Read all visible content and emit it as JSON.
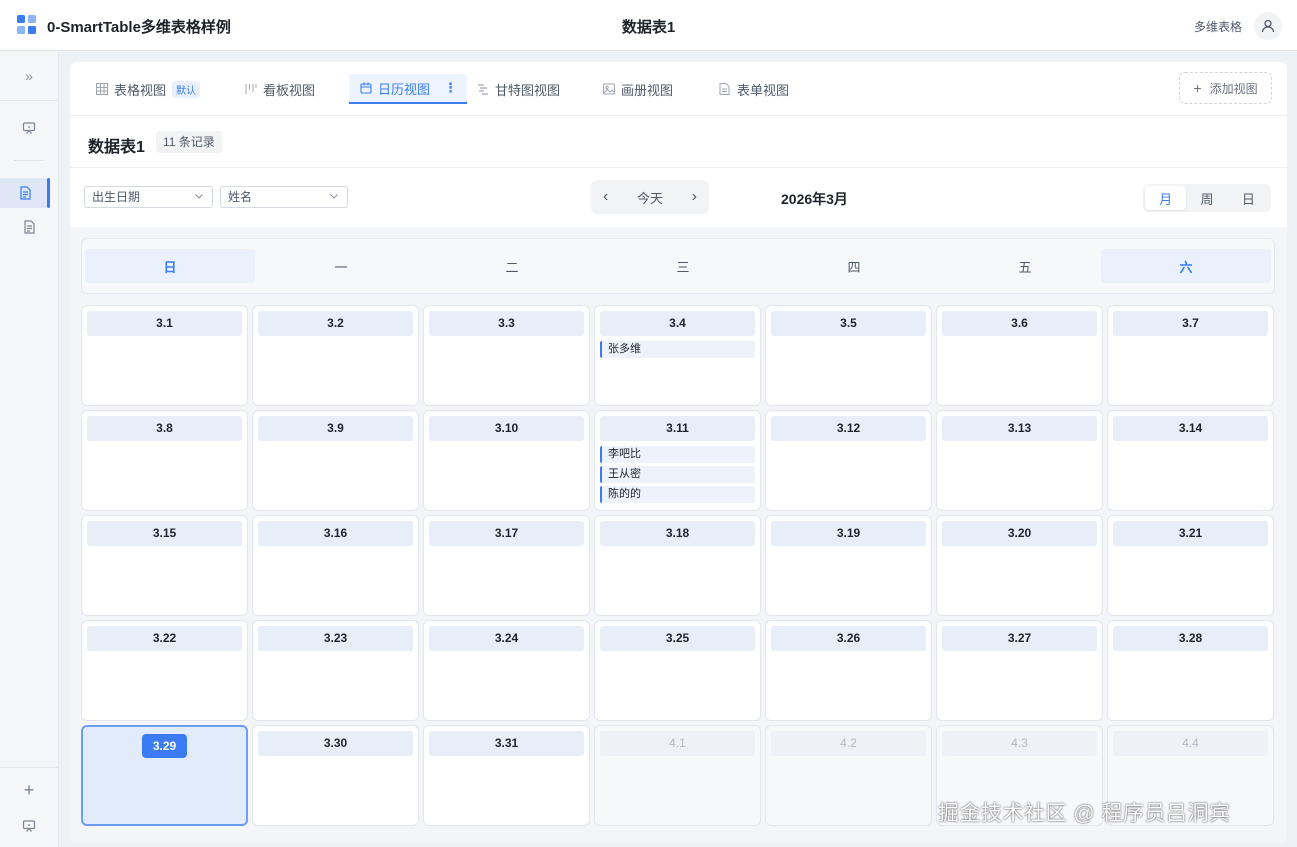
{
  "app": {
    "title": "0-SmartTable多维表格样例",
    "center_title": "数据表1",
    "right_label": "多维表格"
  },
  "tabs": [
    {
      "label": "表格视图",
      "badge": "默认",
      "icon": "grid-icon"
    },
    {
      "label": "看板视图",
      "icon": "kanban-icon"
    },
    {
      "label": "日历视图",
      "icon": "calendar-icon",
      "active": true
    },
    {
      "label": "甘特图视图",
      "icon": "gantt-icon"
    },
    {
      "label": "画册视图",
      "icon": "image-icon"
    },
    {
      "label": "表单视图",
      "icon": "form-icon"
    }
  ],
  "add_view_label": "添加视图",
  "table": {
    "name": "数据表1",
    "record_count": "11 条记录"
  },
  "toolbar": {
    "date_field": "出生日期",
    "title_field": "姓名",
    "prev": "‹",
    "today": "今天",
    "next": "›",
    "month_title": "2026年3月",
    "modes": [
      "月",
      "周",
      "日"
    ],
    "active_mode": "月"
  },
  "weekdays": [
    "日",
    "一",
    "二",
    "三",
    "四",
    "五",
    "六"
  ],
  "weeks": [
    [
      {
        "d": "3.1"
      },
      {
        "d": "3.2"
      },
      {
        "d": "3.3"
      },
      {
        "d": "3.4",
        "events": [
          "张多维"
        ]
      },
      {
        "d": "3.5"
      },
      {
        "d": "3.6"
      },
      {
        "d": "3.7"
      }
    ],
    [
      {
        "d": "3.8"
      },
      {
        "d": "3.9"
      },
      {
        "d": "3.10"
      },
      {
        "d": "3.11",
        "events": [
          "李吧比",
          "王从密",
          "陈的的"
        ]
      },
      {
        "d": "3.12"
      },
      {
        "d": "3.13"
      },
      {
        "d": "3.14"
      }
    ],
    [
      {
        "d": "3.15"
      },
      {
        "d": "3.16"
      },
      {
        "d": "3.17"
      },
      {
        "d": "3.18"
      },
      {
        "d": "3.19"
      },
      {
        "d": "3.20"
      },
      {
        "d": "3.21"
      }
    ],
    [
      {
        "d": "3.22"
      },
      {
        "d": "3.23"
      },
      {
        "d": "3.24"
      },
      {
        "d": "3.25"
      },
      {
        "d": "3.26"
      },
      {
        "d": "3.27"
      },
      {
        "d": "3.28"
      }
    ],
    [
      {
        "d": "3.29",
        "today": true
      },
      {
        "d": "3.30"
      },
      {
        "d": "3.31"
      },
      {
        "d": "4.1",
        "other": true
      },
      {
        "d": "4.2",
        "other": true
      },
      {
        "d": "4.3",
        "other": true
      },
      {
        "d": "4.4",
        "other": true
      }
    ]
  ],
  "watermark": "掘金技术社区 @ 程序员吕洞宾",
  "colors": {
    "accent": "#3b7cf5",
    "today_bg": "#e2ebfa",
    "date_head_bg": "#e8eef8"
  }
}
